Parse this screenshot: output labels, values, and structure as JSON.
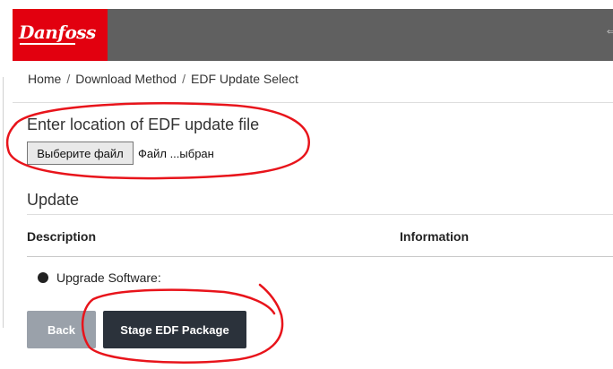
{
  "brand": {
    "logo_text": "Danfoss",
    "accent": "#e2000f",
    "header_bg": "#606060"
  },
  "header": {
    "right_icon": "arrow-icon",
    "right_icon_glyph": "⇔"
  },
  "breadcrumb": {
    "items": [
      "Home",
      "Download Method",
      "EDF Update Select"
    ],
    "separator": "/"
  },
  "file_section": {
    "heading": "Enter location of EDF update file",
    "choose_button_label": "Выберите файл",
    "file_status": "Файл ...ыбран"
  },
  "update_section": {
    "title": "Update",
    "columns": [
      "Description",
      "Information"
    ],
    "rows": [
      {
        "description": "Upgrade Software:",
        "information": ""
      }
    ]
  },
  "actions": {
    "back_label": "Back",
    "stage_label": "Stage EDF Package"
  },
  "annotation_color": "#e8141b"
}
